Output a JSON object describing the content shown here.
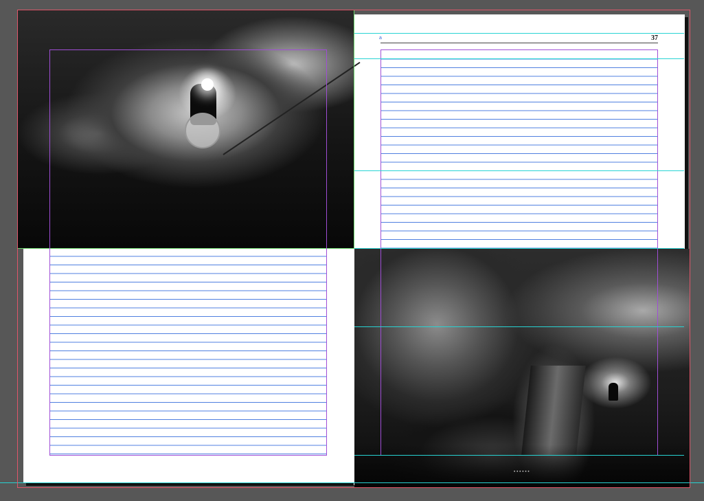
{
  "spread": {
    "page_number_right": "37",
    "running_head_marker": "a",
    "caption_text": "• • • • • •"
  },
  "photos": {
    "left": {
      "icon": "cave-caver-photo"
    },
    "right": {
      "icon": "cave-chamber-photo"
    }
  },
  "colors": {
    "pasteboard": "#575757",
    "page": "#ffffff",
    "bleed_guide": "#e0566a",
    "margin_guide": "#a04ed6",
    "baseline_grid": "#4f7fe0",
    "ruler_guide": "#27d3d3",
    "frame_selected": "#6bd66b"
  }
}
